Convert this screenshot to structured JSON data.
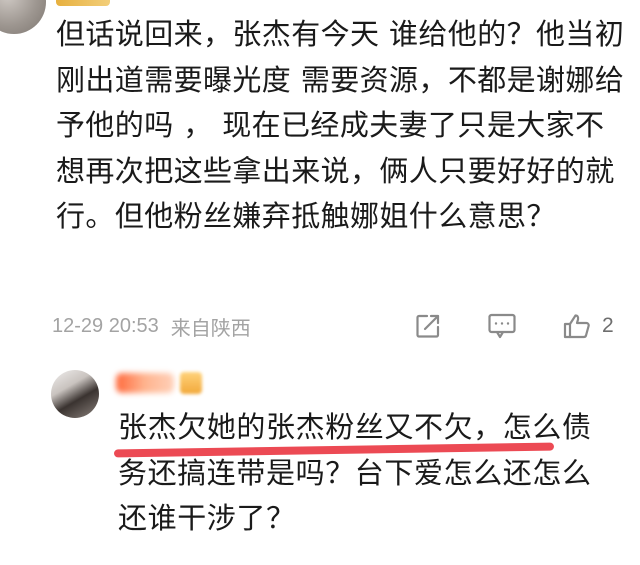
{
  "comment": {
    "text": "但话说回来，张杰有今天 谁给他的？他当初刚出道需要曝光度 需要资源，不都是谢娜给予他的吗 ， 现在已经成夫妻了只是大家不想再次把这些拿出来说，俩人只要好好的就行。但他粉丝嫌弃抵触娜姐什么意思？",
    "date": "12-29 20:53",
    "location": "来自陕西",
    "like_count": "2",
    "icons": [
      "share-icon",
      "comment-icon",
      "like-icon"
    ]
  },
  "reply": {
    "text": "张杰欠她的张杰粉丝又不欠，怎么债务还搞连带是吗？台下爱怎么还怎么还谁干涉了？",
    "underline_color": "#ea3b45"
  },
  "colors": {
    "text": "#1a1a1a",
    "meta": "#a3a3a3",
    "icon": "#8a8a8a"
  }
}
